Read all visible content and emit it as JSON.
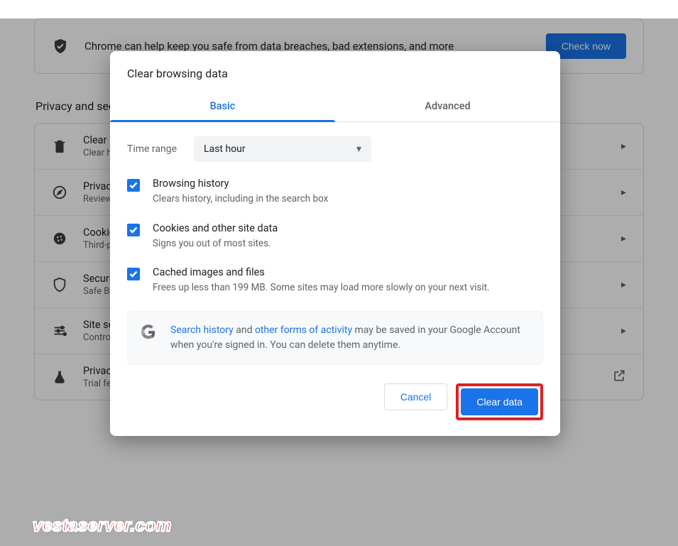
{
  "bg": {
    "safety_text": "Chrome can help keep you safe from data breaches, bad extensions, and more",
    "check_now": "Check now",
    "section_title": "Privacy and security",
    "rows": [
      {
        "title": "Clear browsing data",
        "sub": "Clear history, cookies, cache, and more"
      },
      {
        "title": "Privacy Guide",
        "sub": "Review key privacy and security controls"
      },
      {
        "title": "Cookies and other site data",
        "sub": "Third-party cookies are blocked in Incognito mode"
      },
      {
        "title": "Security",
        "sub": "Safe Browsing (protection from dangerous sites) and other security settings"
      },
      {
        "title": "Site settings",
        "sub": "Controls what information sites can use and show"
      },
      {
        "title": "Privacy Sandbox",
        "sub": "Trial features are on"
      }
    ]
  },
  "modal": {
    "title": "Clear browsing data",
    "tabs": {
      "basic": "Basic",
      "advanced": "Advanced"
    },
    "time_label": "Time range",
    "time_value": "Last hour",
    "options": [
      {
        "title": "Browsing history",
        "sub": "Clears history, including in the search box"
      },
      {
        "title": "Cookies and other site data",
        "sub": "Signs you out of most sites."
      },
      {
        "title": "Cached images and files",
        "sub": "Frees up less than 199 MB. Some sites may load more slowly on your next visit."
      }
    ],
    "info": {
      "link1": "Search history",
      "mid": " and ",
      "link2": "other forms of activity",
      "rest": " may be saved in your Google Account when you're signed in. You can delete them anytime."
    },
    "cancel": "Cancel",
    "clear": "Clear data"
  },
  "watermark": "vestaserver.com"
}
